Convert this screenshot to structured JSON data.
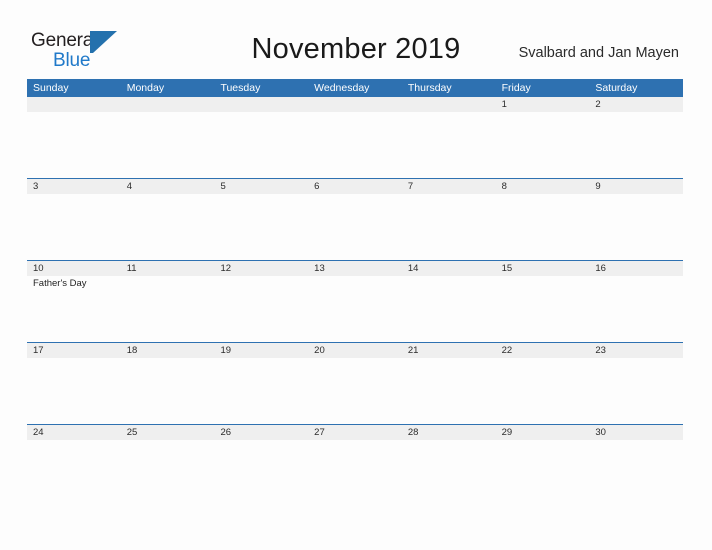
{
  "brand": {
    "name_dark": "General",
    "name_blue": "Blue",
    "mark": "triangle-logo-icon",
    "accent_blue": "#2471ad",
    "text_dark": "#231f20"
  },
  "header": {
    "title": "November 2019",
    "region": "Svalbard and Jan Mayen"
  },
  "colors": {
    "header_blue": "#2e71b1",
    "date_band_gray": "#efefef",
    "page_background": "#fdfdfd",
    "rule_blue": "#2e71b1"
  },
  "calendar": {
    "weekday_headers": [
      "Sunday",
      "Monday",
      "Tuesday",
      "Wednesday",
      "Thursday",
      "Friday",
      "Saturday"
    ],
    "weeks": [
      {
        "days": [
          {
            "date": "",
            "events": []
          },
          {
            "date": "",
            "events": []
          },
          {
            "date": "",
            "events": []
          },
          {
            "date": "",
            "events": []
          },
          {
            "date": "",
            "events": []
          },
          {
            "date": "1",
            "events": []
          },
          {
            "date": "2",
            "events": []
          }
        ]
      },
      {
        "days": [
          {
            "date": "3",
            "events": []
          },
          {
            "date": "4",
            "events": []
          },
          {
            "date": "5",
            "events": []
          },
          {
            "date": "6",
            "events": []
          },
          {
            "date": "7",
            "events": []
          },
          {
            "date": "8",
            "events": []
          },
          {
            "date": "9",
            "events": []
          }
        ]
      },
      {
        "days": [
          {
            "date": "10",
            "events": [
              "Father's Day"
            ]
          },
          {
            "date": "11",
            "events": []
          },
          {
            "date": "12",
            "events": []
          },
          {
            "date": "13",
            "events": []
          },
          {
            "date": "14",
            "events": []
          },
          {
            "date": "15",
            "events": []
          },
          {
            "date": "16",
            "events": []
          }
        ]
      },
      {
        "days": [
          {
            "date": "17",
            "events": []
          },
          {
            "date": "18",
            "events": []
          },
          {
            "date": "19",
            "events": []
          },
          {
            "date": "20",
            "events": []
          },
          {
            "date": "21",
            "events": []
          },
          {
            "date": "22",
            "events": []
          },
          {
            "date": "23",
            "events": []
          }
        ]
      },
      {
        "days": [
          {
            "date": "24",
            "events": []
          },
          {
            "date": "25",
            "events": []
          },
          {
            "date": "26",
            "events": []
          },
          {
            "date": "27",
            "events": []
          },
          {
            "date": "28",
            "events": []
          },
          {
            "date": "29",
            "events": []
          },
          {
            "date": "30",
            "events": []
          }
        ]
      }
    ]
  }
}
